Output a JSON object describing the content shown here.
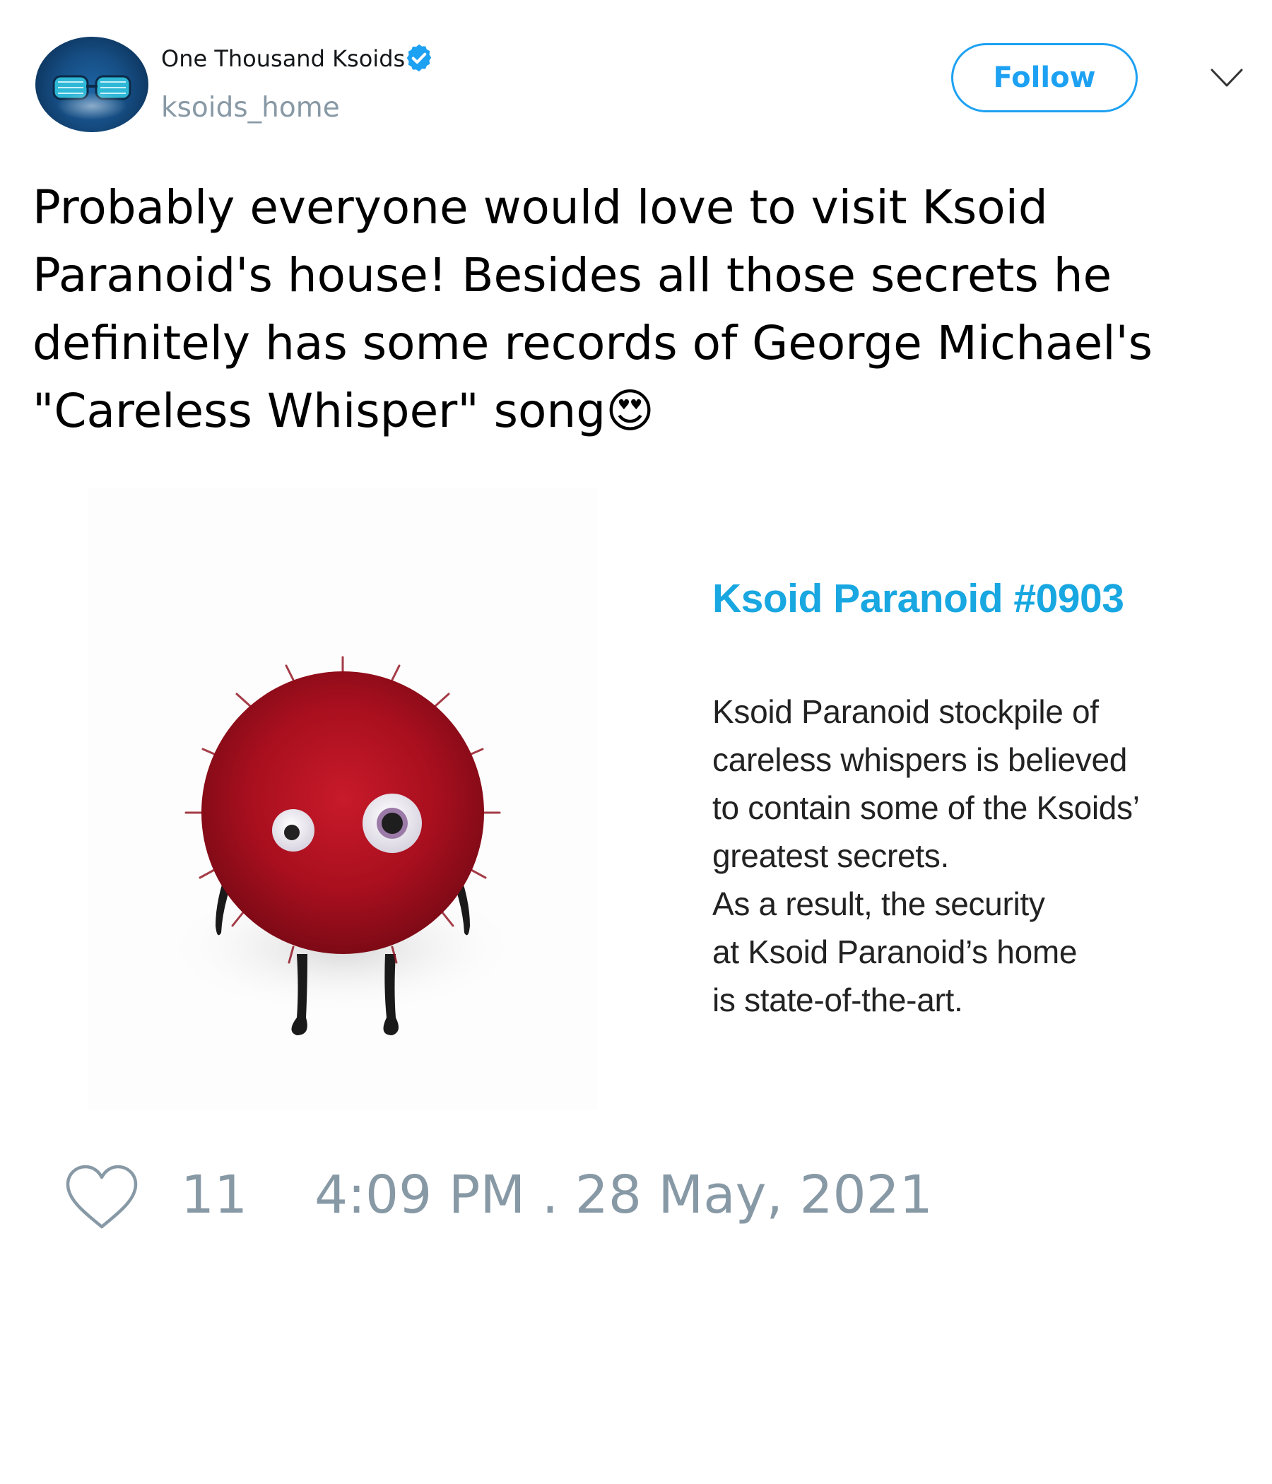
{
  "author": {
    "display_name": "One Thousand Ksoids",
    "handle": "ksoids_home",
    "verified": true,
    "avatar_icon": "ksoid-avatar"
  },
  "actions": {
    "follow_label": "Follow",
    "menu_icon": "chevron-down-icon"
  },
  "tweet": {
    "text": "Probably everyone would love to visit Ksoid\nParanoid's house! Besides all those secrets he\ndefinitely has some records of George Michael's\n\"Careless Whisper\" song😍"
  },
  "media": {
    "title": "Ksoid Paranoid #0903",
    "body_lines": [
      "Ksoid Paranoid stockpile of",
      "careless whispers is believed",
      "to contain some of the Ksoids’",
      "greatest secrets.",
      "As a result, the security",
      "at Ksoid Paranoid’s home",
      "is state-of-the-art."
    ]
  },
  "footer": {
    "like_icon": "heart-icon",
    "like_count": "11",
    "timestamp": "4:09 PM . 28 May, 2021"
  },
  "colors": {
    "accent": "#1da1f2",
    "muted": "#8899a6",
    "card_title": "#18a7e0",
    "creature_fur": "#b0121f"
  }
}
